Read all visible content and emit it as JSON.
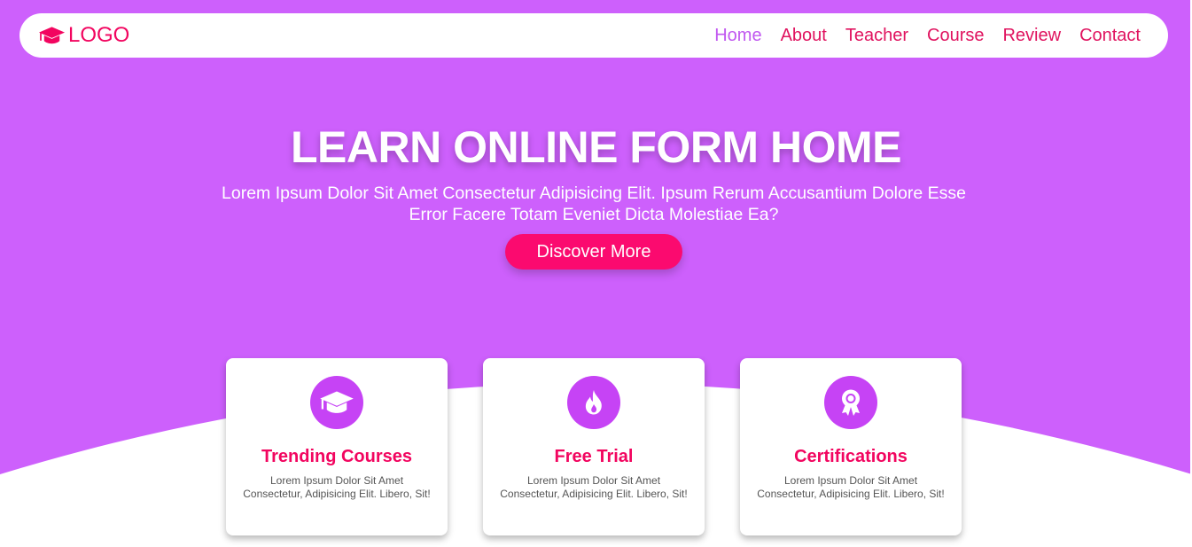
{
  "colors": {
    "hero_background": "#cd60fc",
    "accent_pink": "#f2055f",
    "nav_active": "#c158f0",
    "button": "#fb0a6f",
    "icon_circle": "#c643f5",
    "white": "#ffffff"
  },
  "navbar": {
    "logo_icon": "graduation-cap-icon",
    "logo_text": "LOGO",
    "links": [
      {
        "label": "Home",
        "active": true
      },
      {
        "label": "About",
        "active": false
      },
      {
        "label": "Teacher",
        "active": false
      },
      {
        "label": "Course",
        "active": false
      },
      {
        "label": "Review",
        "active": false
      },
      {
        "label": "Contact",
        "active": false
      }
    ]
  },
  "hero": {
    "title": "LEARN ONLINE FORM HOME",
    "text": "Lorem Ipsum Dolor Sit Amet Consectetur Adipisicing Elit. Ipsum Rerum Accusantium Dolore Esse Error Facere Totam Eveniet Dicta Molestiae Ea?",
    "button_label": "Discover More"
  },
  "features": [
    {
      "icon": "graduation-cap-icon",
      "title": "Trending Courses",
      "text": "Lorem Ipsum Dolor Sit Amet Consectetur, Adipisicing Elit. Libero, Sit!"
    },
    {
      "icon": "fire-icon",
      "title": "Free Trial",
      "text": "Lorem Ipsum Dolor Sit Amet Consectetur, Adipisicing Elit. Libero, Sit!"
    },
    {
      "icon": "award-icon",
      "title": "Certifications",
      "text": "Lorem Ipsum Dolor Sit Amet Consectetur, Adipisicing Elit. Libero, Sit!"
    }
  ]
}
